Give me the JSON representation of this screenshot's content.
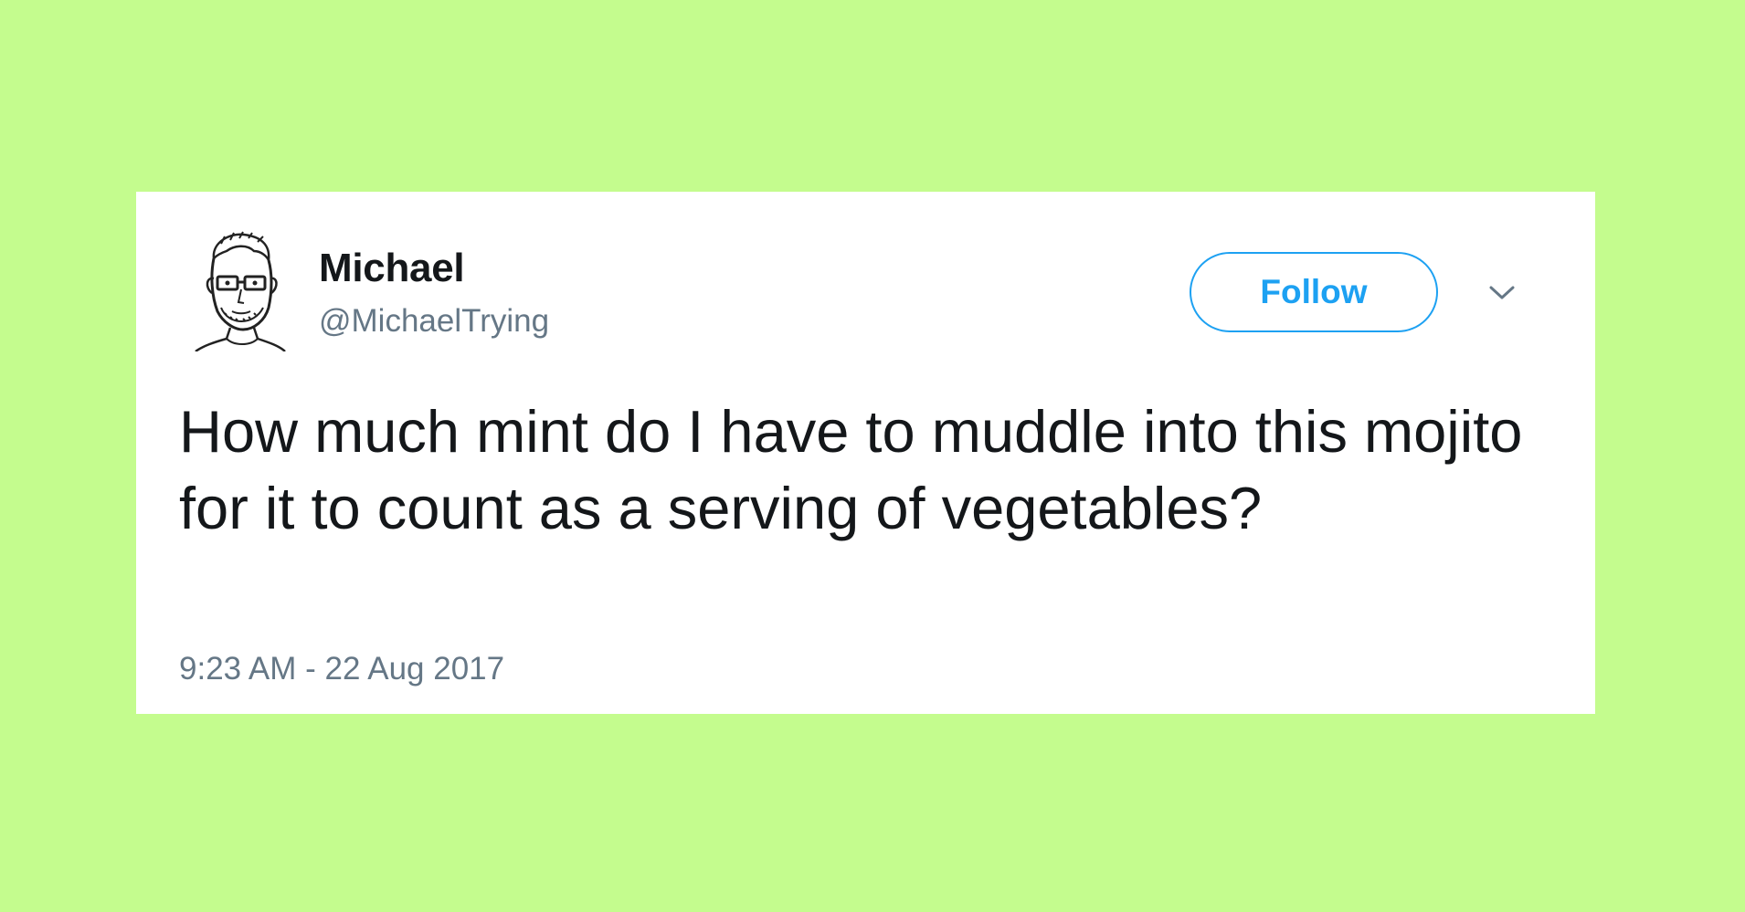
{
  "tweet": {
    "author": {
      "name": "Michael",
      "handle": "@MichaelTrying",
      "avatar_icon": "sketch-portrait-avatar"
    },
    "follow_label": "Follow",
    "menu_icon": "chevron-down-icon",
    "text": "How much mint do I have to muddle into this mojito for it to count as a serving of vegetables?",
    "timestamp": "9:23 AM - 22 Aug 2017"
  },
  "colors": {
    "background": "#c4fc8e",
    "card": "#ffffff",
    "accent": "#1da1f2",
    "text": "#14171a",
    "secondary_text": "#657786"
  }
}
